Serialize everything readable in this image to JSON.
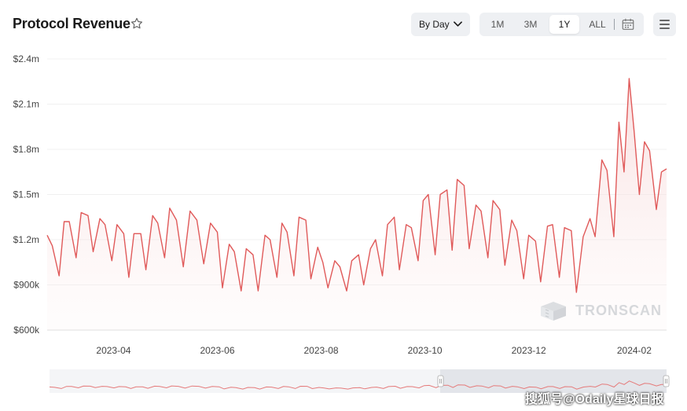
{
  "header": {
    "title": "Protocol Revenue",
    "interval_label": "By Day",
    "ranges": [
      "1M",
      "3M",
      "1Y",
      "ALL"
    ],
    "active_range": "1Y",
    "icons": {
      "favorite": "star-outline-icon",
      "interval": "chevron-down-icon",
      "calendar": "calendar-icon",
      "menu": "hamburger-menu-icon"
    }
  },
  "watermark": {
    "text": "TRONSCAN",
    "icon": "tronscan-logo-icon"
  },
  "overlay_caption": "搜狐号@Odaily星球日报",
  "colors": {
    "line": "#e05a5a",
    "area_top": "#f7d6d6",
    "grid": "#eeeeee",
    "navigator_mask": "#e6e8ec"
  },
  "chart_data": {
    "type": "line",
    "title": "Protocol Revenue",
    "xlabel": "",
    "ylabel": "",
    "x_range": [
      "2023-02-21",
      "2024-02-20"
    ],
    "ylim": [
      600000,
      2400000
    ],
    "y_ticks": [
      {
        "value": 600000,
        "label": "$600k"
      },
      {
        "value": 900000,
        "label": "$900k"
      },
      {
        "value": 1200000,
        "label": "$1.2m"
      },
      {
        "value": 1500000,
        "label": "$1.5m"
      },
      {
        "value": 1800000,
        "label": "$1.8m"
      },
      {
        "value": 2100000,
        "label": "$2.1m"
      },
      {
        "value": 2400000,
        "label": "$2.4m"
      }
    ],
    "x_ticks": [
      {
        "date": "2023-04-01",
        "label": "2023-04"
      },
      {
        "date": "2023-06-01",
        "label": "2023-06"
      },
      {
        "date": "2023-08-01",
        "label": "2023-08"
      },
      {
        "date": "2023-10-01",
        "label": "2023-10"
      },
      {
        "date": "2023-12-01",
        "label": "2023-12"
      },
      {
        "date": "2024-02-01",
        "label": "2024-02"
      }
    ],
    "grid": true,
    "legend": "none",
    "series": [
      {
        "values": [
          [
            "2023-02-21",
            1230000
          ],
          [
            "2023-02-24",
            1160000
          ],
          [
            "2023-02-28",
            960000
          ],
          [
            "2023-03-03",
            1320000
          ],
          [
            "2023-03-06",
            1320000
          ],
          [
            "2023-03-10",
            1080000
          ],
          [
            "2023-03-13",
            1380000
          ],
          [
            "2023-03-17",
            1360000
          ],
          [
            "2023-03-20",
            1120000
          ],
          [
            "2023-03-24",
            1340000
          ],
          [
            "2023-03-27",
            1300000
          ],
          [
            "2023-03-31",
            1060000
          ],
          [
            "2023-04-03",
            1300000
          ],
          [
            "2023-04-07",
            1240000
          ],
          [
            "2023-04-10",
            950000
          ],
          [
            "2023-04-13",
            1240000
          ],
          [
            "2023-04-17",
            1240000
          ],
          [
            "2023-04-20",
            1000000
          ],
          [
            "2023-04-24",
            1360000
          ],
          [
            "2023-04-27",
            1310000
          ],
          [
            "2023-05-01",
            1080000
          ],
          [
            "2023-05-04",
            1410000
          ],
          [
            "2023-05-08",
            1330000
          ],
          [
            "2023-05-12",
            1020000
          ],
          [
            "2023-05-16",
            1390000
          ],
          [
            "2023-05-20",
            1330000
          ],
          [
            "2023-05-24",
            1040000
          ],
          [
            "2023-05-28",
            1310000
          ],
          [
            "2023-06-01",
            1250000
          ],
          [
            "2023-06-04",
            880000
          ],
          [
            "2023-06-08",
            1170000
          ],
          [
            "2023-06-11",
            1120000
          ],
          [
            "2023-06-15",
            860000
          ],
          [
            "2023-06-18",
            1140000
          ],
          [
            "2023-06-22",
            1100000
          ],
          [
            "2023-06-25",
            860000
          ],
          [
            "2023-06-29",
            1230000
          ],
          [
            "2023-07-02",
            1200000
          ],
          [
            "2023-07-06",
            950000
          ],
          [
            "2023-07-09",
            1310000
          ],
          [
            "2023-07-12",
            1250000
          ],
          [
            "2023-07-16",
            960000
          ],
          [
            "2023-07-19",
            1350000
          ],
          [
            "2023-07-23",
            1330000
          ],
          [
            "2023-07-26",
            940000
          ],
          [
            "2023-07-30",
            1150000
          ],
          [
            "2023-08-02",
            1050000
          ],
          [
            "2023-08-05",
            880000
          ],
          [
            "2023-08-09",
            1060000
          ],
          [
            "2023-08-12",
            1020000
          ],
          [
            "2023-08-16",
            860000
          ],
          [
            "2023-08-19",
            1060000
          ],
          [
            "2023-08-23",
            1100000
          ],
          [
            "2023-08-26",
            900000
          ],
          [
            "2023-08-30",
            1140000
          ],
          [
            "2023-09-02",
            1200000
          ],
          [
            "2023-09-06",
            960000
          ],
          [
            "2023-09-09",
            1300000
          ],
          [
            "2023-09-13",
            1350000
          ],
          [
            "2023-09-16",
            1000000
          ],
          [
            "2023-09-20",
            1300000
          ],
          [
            "2023-09-23",
            1280000
          ],
          [
            "2023-09-27",
            1060000
          ],
          [
            "2023-09-30",
            1460000
          ],
          [
            "2023-10-03",
            1500000
          ],
          [
            "2023-10-07",
            1100000
          ],
          [
            "2023-10-10",
            1500000
          ],
          [
            "2023-10-14",
            1530000
          ],
          [
            "2023-10-17",
            1130000
          ],
          [
            "2023-10-20",
            1600000
          ],
          [
            "2023-10-24",
            1560000
          ],
          [
            "2023-10-27",
            1140000
          ],
          [
            "2023-10-31",
            1430000
          ],
          [
            "2023-11-03",
            1390000
          ],
          [
            "2023-11-07",
            1080000
          ],
          [
            "2023-11-10",
            1460000
          ],
          [
            "2023-11-14",
            1400000
          ],
          [
            "2023-11-17",
            1030000
          ],
          [
            "2023-11-21",
            1330000
          ],
          [
            "2023-11-24",
            1260000
          ],
          [
            "2023-11-28",
            940000
          ],
          [
            "2023-12-01",
            1230000
          ],
          [
            "2023-12-05",
            1190000
          ],
          [
            "2023-12-08",
            920000
          ],
          [
            "2023-12-12",
            1290000
          ],
          [
            "2023-12-15",
            1300000
          ],
          [
            "2023-12-19",
            950000
          ],
          [
            "2023-12-22",
            1280000
          ],
          [
            "2023-12-26",
            1260000
          ],
          [
            "2023-12-29",
            850000
          ],
          [
            "2024-01-02",
            1220000
          ],
          [
            "2024-01-06",
            1340000
          ],
          [
            "2024-01-09",
            1220000
          ],
          [
            "2024-01-13",
            1730000
          ],
          [
            "2024-01-16",
            1660000
          ],
          [
            "2024-01-20",
            1220000
          ],
          [
            "2024-01-23",
            1980000
          ],
          [
            "2024-01-26",
            1650000
          ],
          [
            "2024-01-29",
            2270000
          ],
          [
            "2024-02-01",
            1910000
          ],
          [
            "2024-02-04",
            1500000
          ],
          [
            "2024-02-07",
            1850000
          ],
          [
            "2024-02-10",
            1790000
          ],
          [
            "2024-02-14",
            1400000
          ],
          [
            "2024-02-17",
            1650000
          ],
          [
            "2024-02-20",
            1670000
          ]
        ]
      }
    ]
  }
}
